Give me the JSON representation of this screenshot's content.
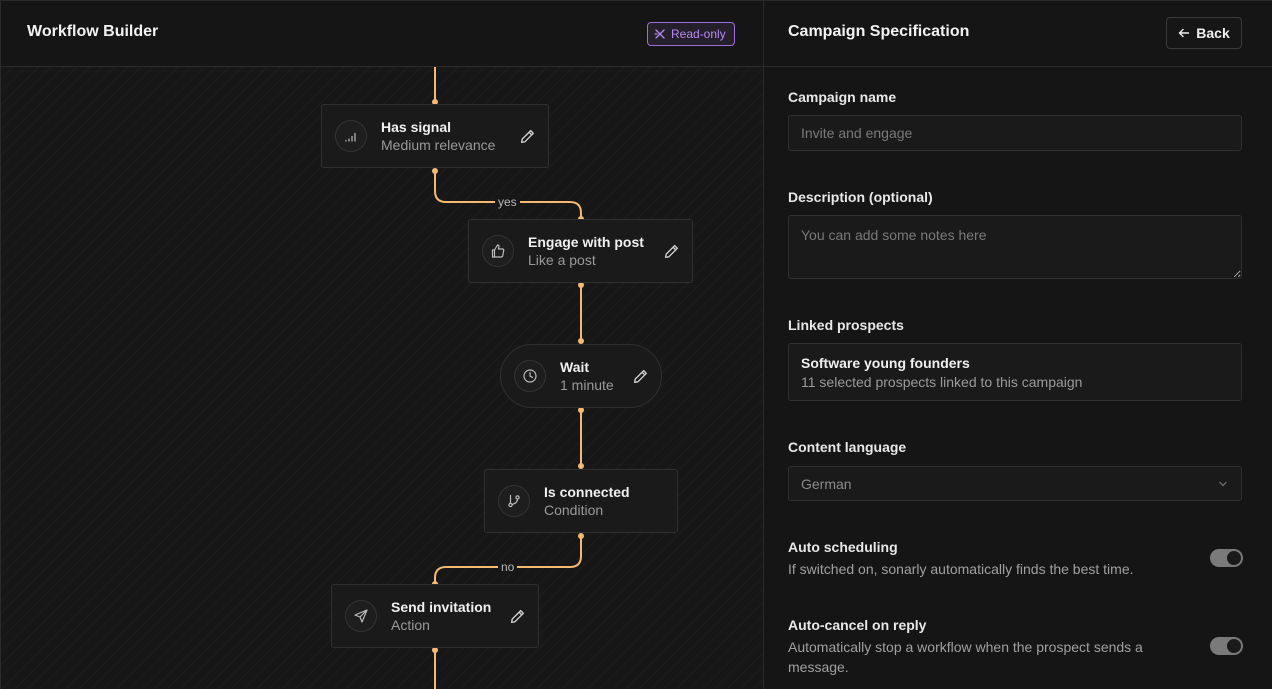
{
  "builder": {
    "title": "Workflow Builder",
    "badge": "Read-only"
  },
  "nodes": [
    {
      "title": "Has signal",
      "subtitle": "Medium relevance",
      "icon": "signal-icon"
    },
    {
      "title": "Engage with post",
      "subtitle": "Like a post",
      "icon": "thumbs-up-icon"
    },
    {
      "title": "Wait",
      "subtitle": "1 minute",
      "icon": "clock-icon"
    },
    {
      "title": "Is connected",
      "subtitle": "Condition",
      "icon": "git-branch-icon"
    },
    {
      "title": "Send invitation",
      "subtitle": "Action",
      "icon": "send-icon"
    }
  ],
  "edge_labels": {
    "yes": "yes",
    "no": "no"
  },
  "spec": {
    "title": "Campaign Specification",
    "back_label": "Back",
    "campaign_name_label": "Campaign name",
    "campaign_name_placeholder": "Invite and engage",
    "description_label": "Description (optional)",
    "description_placeholder": "You can add some notes here",
    "prospects_label": "Linked prospects",
    "prospects_name": "Software young founders",
    "prospects_desc": "11 selected prospects linked to this campaign",
    "language_label": "Content language",
    "language_value": "German",
    "auto_scheduling_title": "Auto scheduling",
    "auto_scheduling_desc": "If switched on, sonarly automatically finds the best time.",
    "auto_cancel_title": "Auto-cancel on reply",
    "auto_cancel_desc": "Automatically stop a workflow when the prospect sends a message."
  },
  "colors": {
    "edge": "#f5b971",
    "badge": "#b78af0",
    "background": "#141414"
  }
}
